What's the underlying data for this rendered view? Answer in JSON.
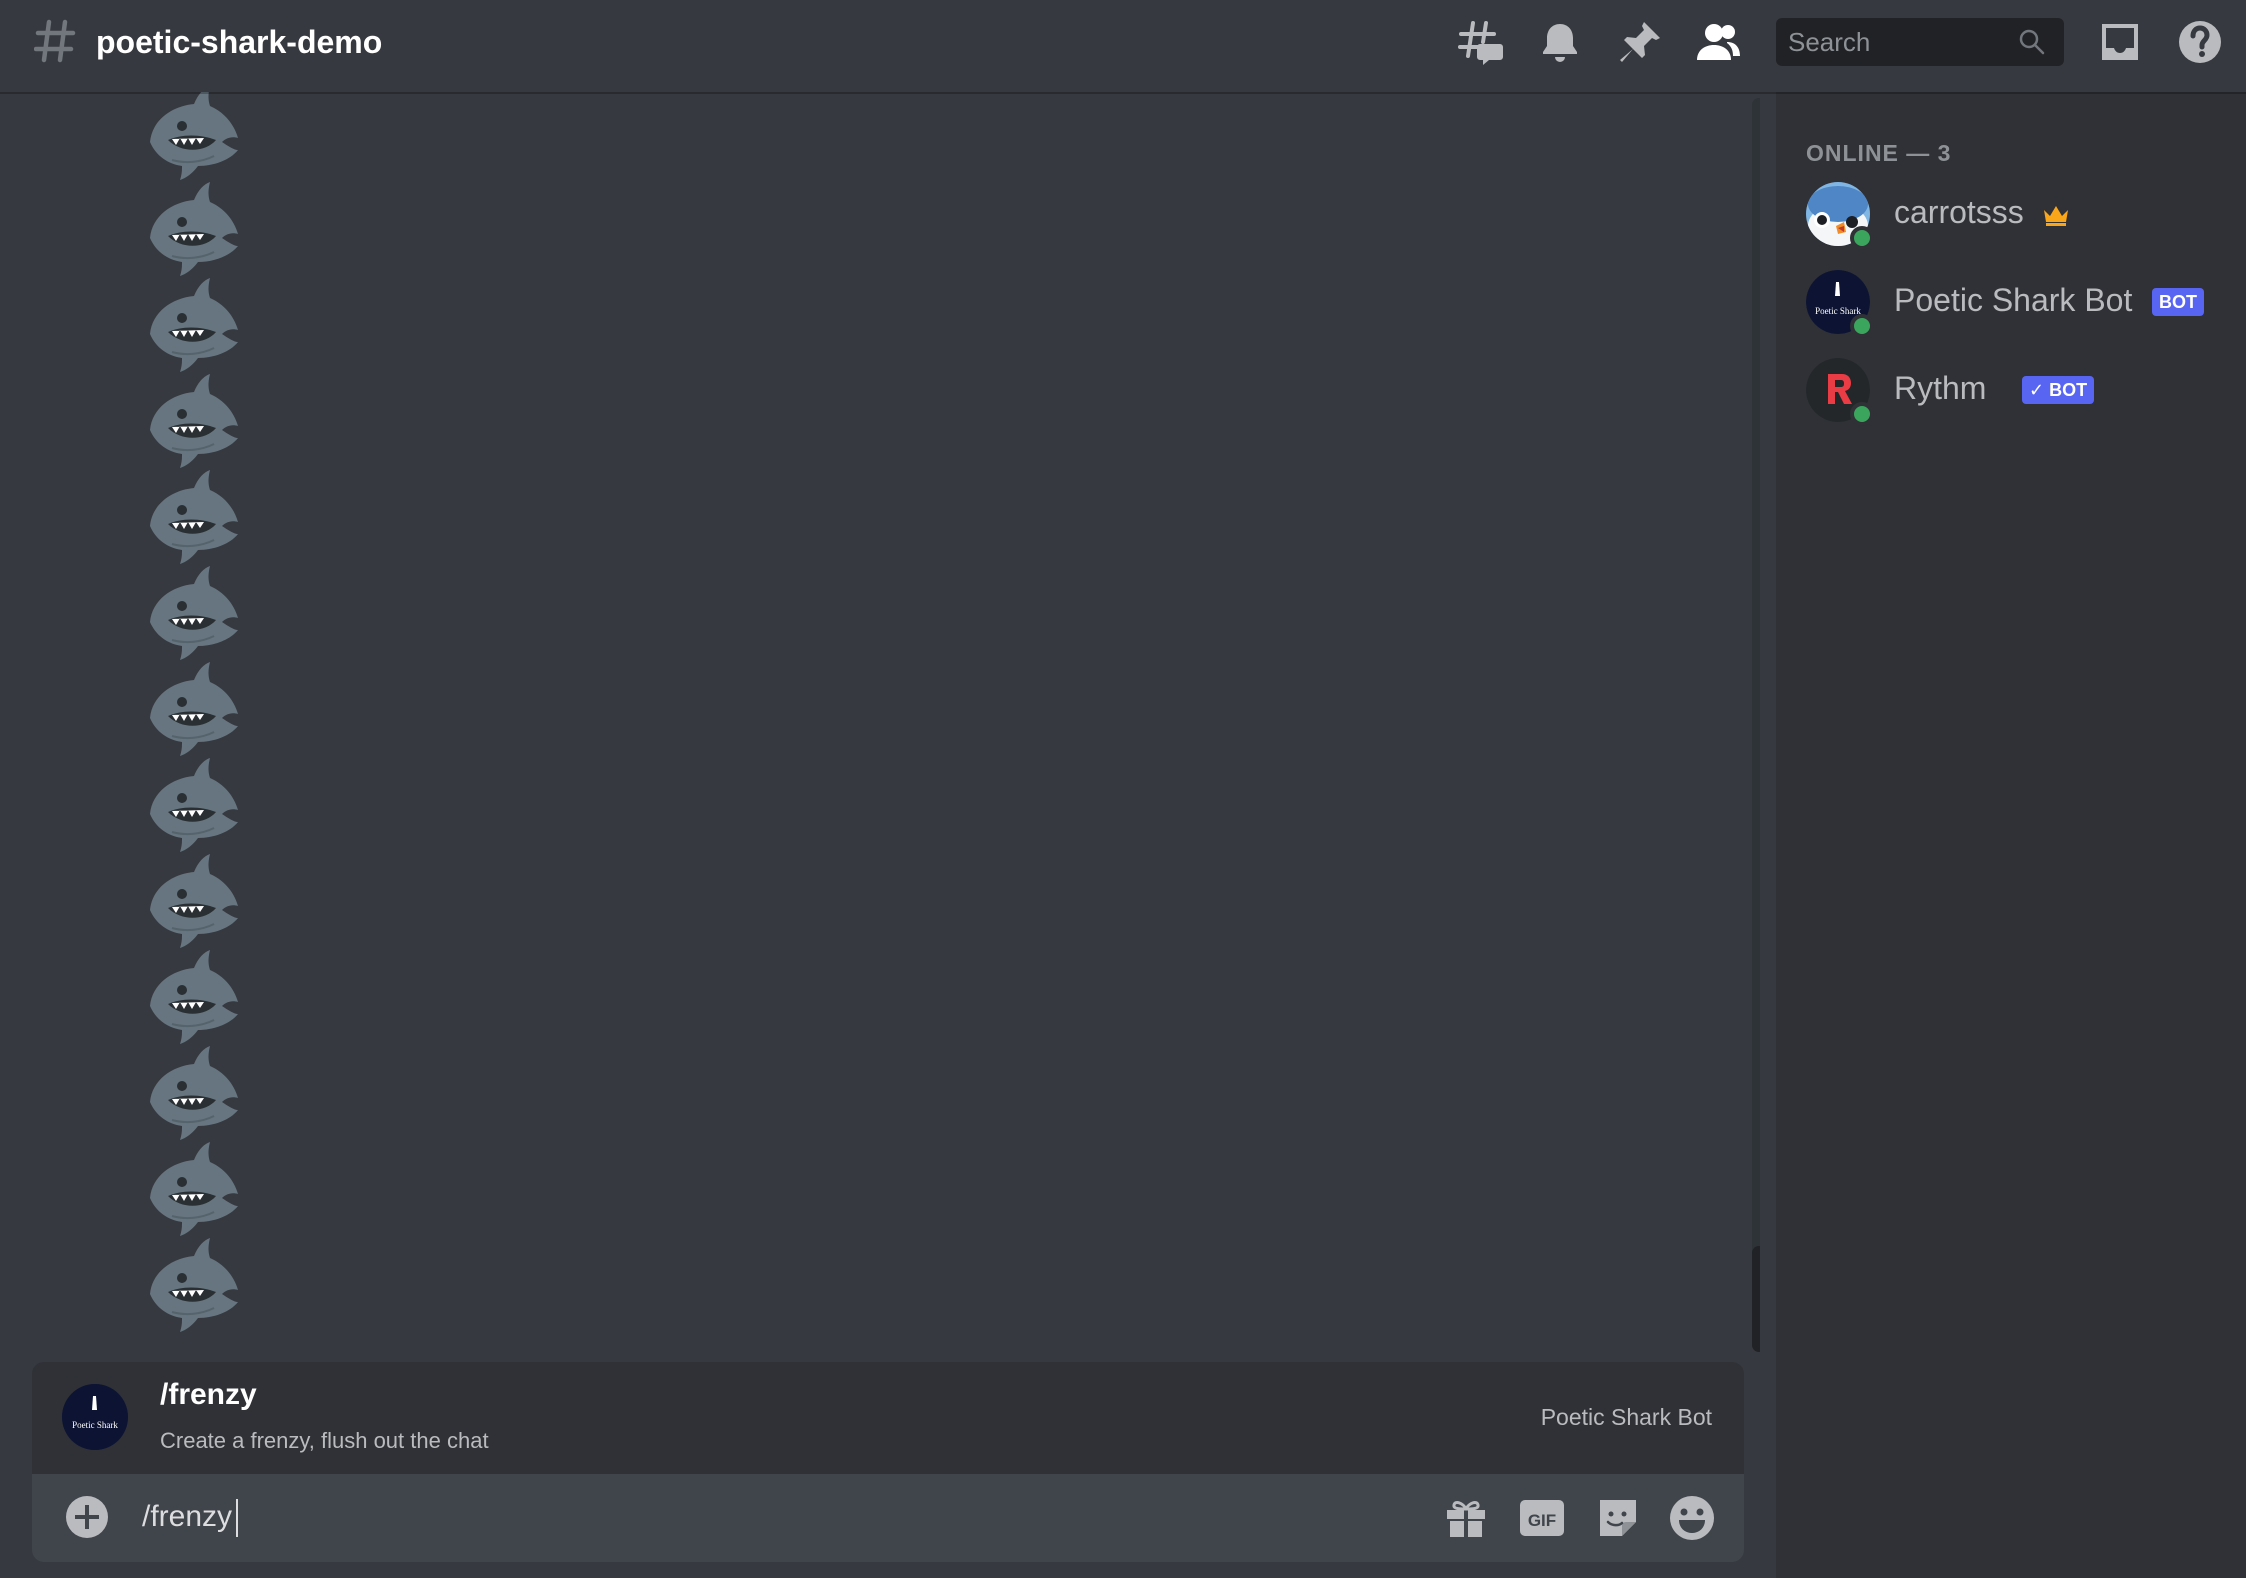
{
  "header": {
    "channel_name": "poetic-shark-demo",
    "search_placeholder": "Search"
  },
  "messages": {
    "emoji": "shark",
    "count": 13
  },
  "autocomplete": {
    "command": "/frenzy",
    "description": "Create a frenzy, flush out the chat",
    "source": "Poetic Shark Bot",
    "avatar_text": "Poetic Shark"
  },
  "composer": {
    "value": "/frenzy"
  },
  "members": {
    "header": "ONLINE — 3",
    "list": [
      {
        "name": "carrotsss",
        "badge": "crown-icon",
        "status": "online"
      },
      {
        "name": "Poetic Shark Bot",
        "tag": "BOT",
        "status": "online",
        "avatar_text": "Poetic Shark"
      },
      {
        "name": "Rythm",
        "tag": "✓ BOT",
        "status": "online"
      }
    ]
  },
  "colors": {
    "background": "#36393f",
    "sidebar": "#2f3136",
    "input": "#40444b",
    "accent": "#5865f2",
    "online": "#3ba55d",
    "crown": "#faa61a",
    "shark": "#66757f"
  }
}
